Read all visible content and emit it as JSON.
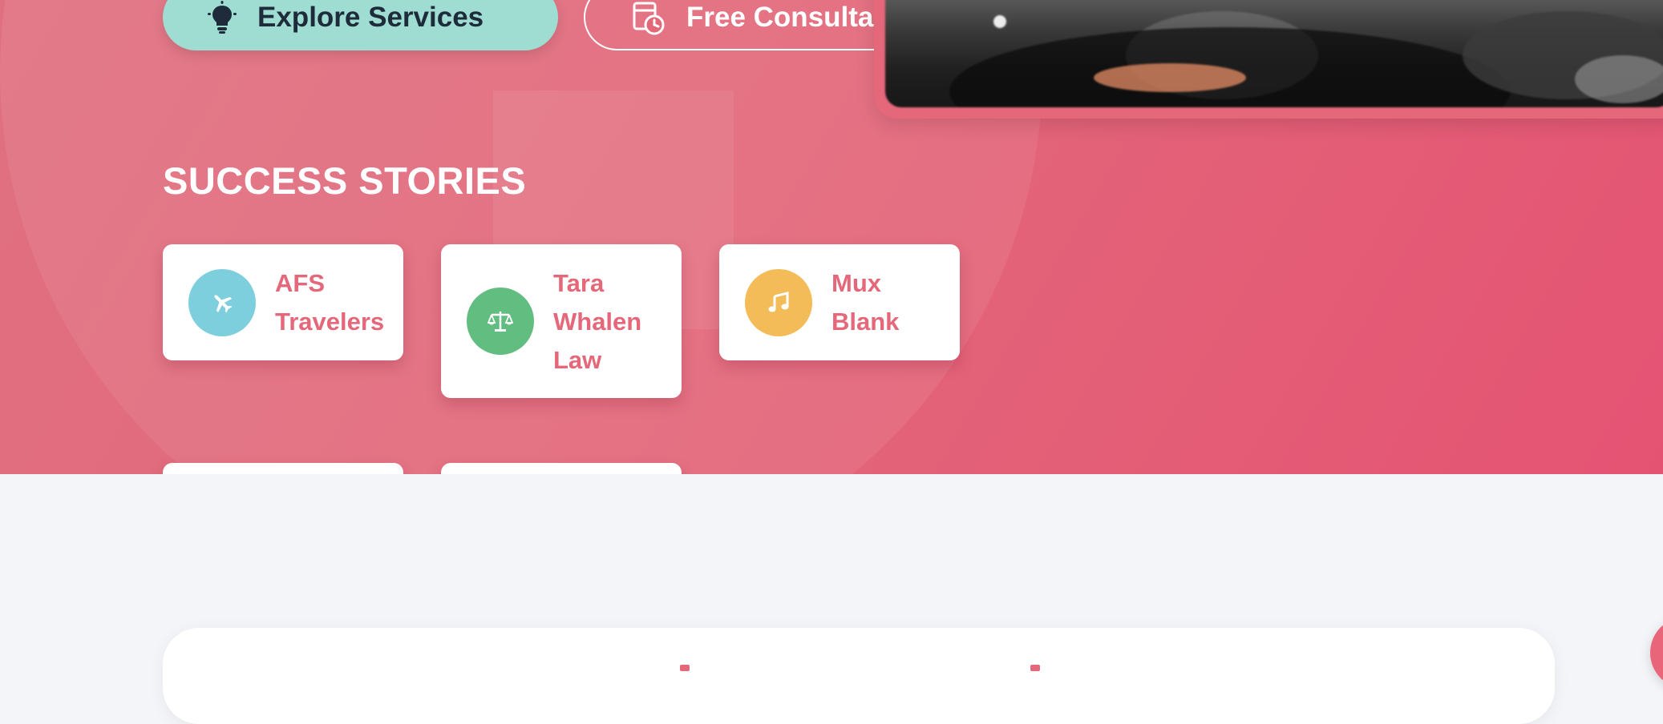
{
  "hero": {
    "buttons": [
      {
        "label": "Explore Services",
        "icon": "lightbulb-icon",
        "color": "#9fdcd1"
      },
      {
        "label": "Free Consulta",
        "icon": "calendar-clock-icon"
      }
    ],
    "section_title": "SUCCESS STORIES",
    "stories": [
      {
        "name_lines": [
          "AFS",
          "Travelers"
        ],
        "icon": "airplane-icon",
        "color": "#7ecfdd"
      },
      {
        "name_lines": [
          "Tara",
          "Whalen",
          "Law"
        ],
        "icon": "scales-icon",
        "color": "#62bd80"
      },
      {
        "name_lines": [
          "Mux",
          "Blank"
        ],
        "icon": "music-note-icon",
        "color": "#f3bc58"
      }
    ]
  },
  "colors": {
    "hero_background": "#e2687a",
    "accent_text": "#e4677a",
    "page_background": "#f4f5f9"
  }
}
